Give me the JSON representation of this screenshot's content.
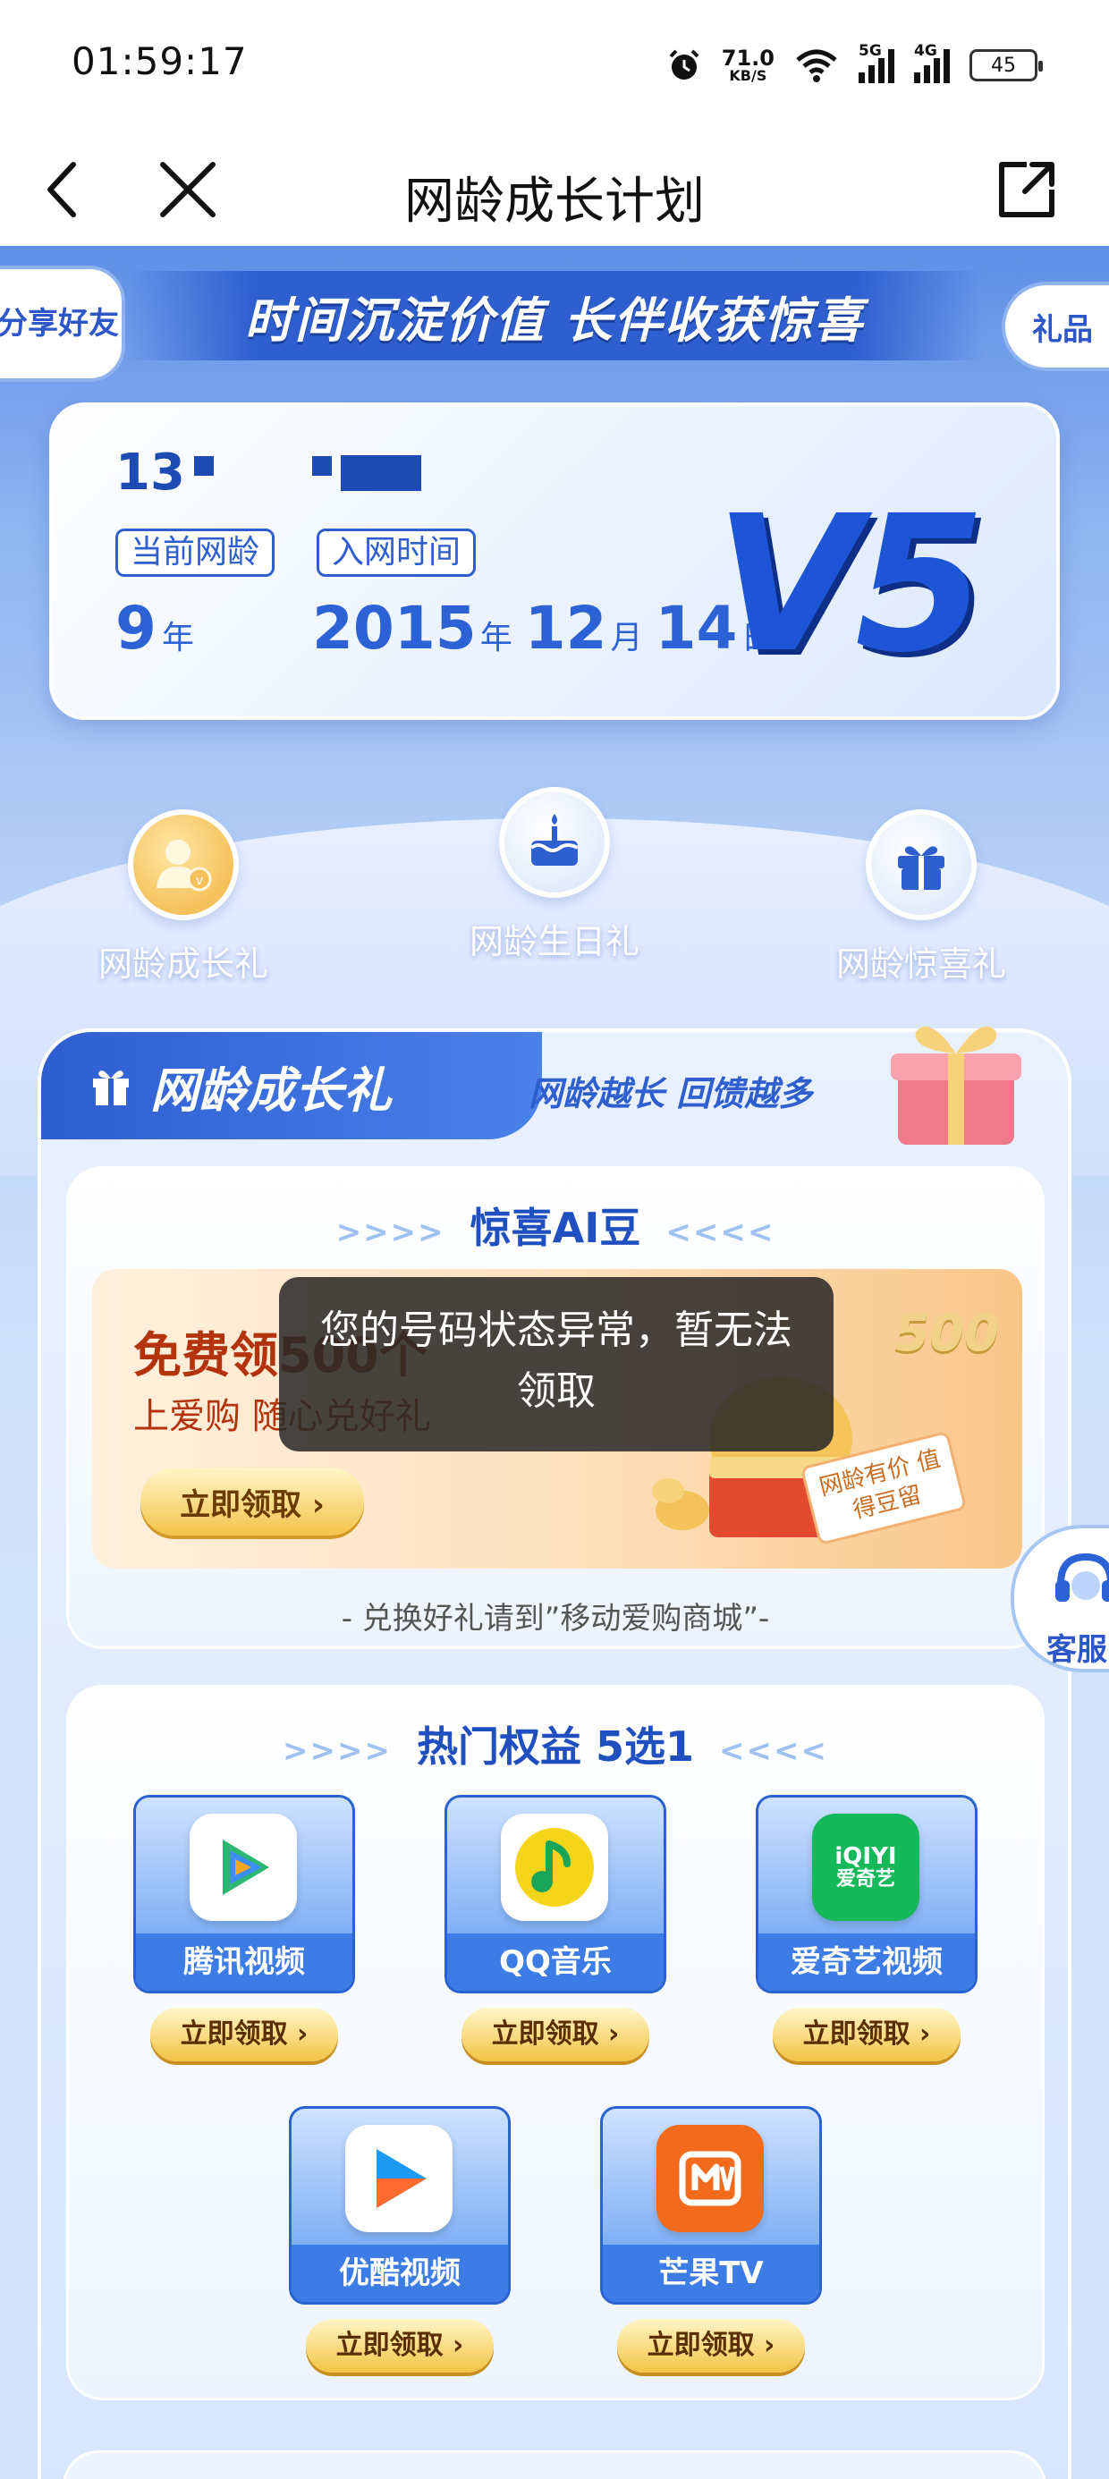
{
  "status_bar": {
    "time": "01:59:17",
    "net_speed": "71.0",
    "net_speed_unit": "KB/S",
    "sig1_label": "5G",
    "sig2_label": "4G",
    "battery": "45"
  },
  "nav": {
    "title": "网龄成长计划"
  },
  "banner": {
    "slogan": "时间沉淀价值  长伴收获惊喜",
    "share_label": "分享好友",
    "gift_label": "礼品"
  },
  "account": {
    "phone_prefix": "13",
    "age_chip": "当前网龄",
    "join_chip": "入网时间",
    "age_value": "9",
    "age_unit": "年",
    "join_year": "2015",
    "join_year_unit": "年",
    "join_month": "12",
    "join_month_unit": "月",
    "join_day": "14",
    "join_day_unit": "日",
    "level": "V5"
  },
  "tabs": [
    {
      "label": "网龄成长礼"
    },
    {
      "label": "网龄生日礼"
    },
    {
      "label": "网龄惊喜礼"
    }
  ],
  "growth": {
    "title": "网龄成长礼",
    "subtitle": "网龄越长 回馈越多",
    "beans_card": {
      "title": "惊喜AI豆",
      "left_arrows": ">>>>",
      "right_arrows": "<<<<",
      "promo_title": "免费领500个",
      "promo_sub": "上爱购 随心兑好礼",
      "promo_button": "立即领取 ›",
      "promo_badge": "500",
      "promo_stamp": "网龄有价 值得豆留",
      "footer": "- 兑换好礼请到”移动爱购商城”-"
    },
    "rights_card": {
      "title": "热门权益 5选1",
      "left_arrows": ">>>>",
      "right_arrows": "<<<<",
      "items": [
        {
          "name": "腾讯视频",
          "button": "立即领取 ›"
        },
        {
          "name": "QQ音乐",
          "button": "立即领取 ›"
        },
        {
          "name": "爱奇艺视频",
          "button": "立即领取 ›",
          "logo_text": "iQIYI",
          "logo_sub": "爱奇艺"
        },
        {
          "name": "优酷视频",
          "button": "立即领取 ›"
        },
        {
          "name": "芒果TV",
          "button": "立即领取 ›"
        }
      ]
    }
  },
  "toast": {
    "message": "您的号码状态异常，暂无法领取"
  },
  "customer_service": {
    "label": "客服"
  },
  "colors": {
    "brand_blue": "#2f5fcf",
    "gold": "#f3c444",
    "toast_bg": "#282828"
  }
}
